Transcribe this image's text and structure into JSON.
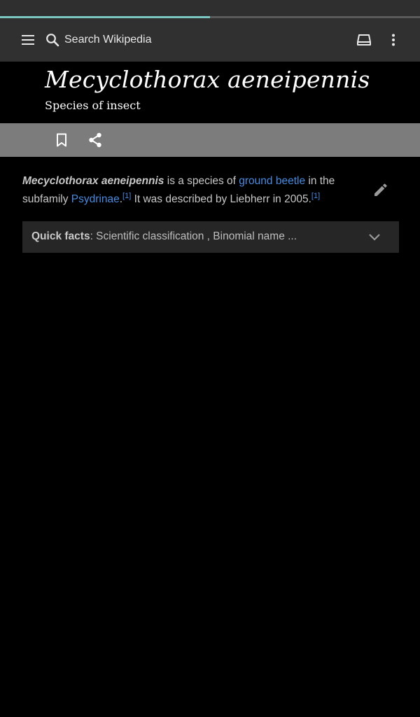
{
  "progress": {
    "fraction": 0.5,
    "color": "#79c7c0"
  },
  "toolbar": {
    "search_placeholder": "Search Wikipedia",
    "icons": [
      "menu-icon",
      "search-icon",
      "reading-list-icon",
      "more-vert-icon"
    ]
  },
  "article": {
    "title": "Mecyclothorax aeneipennis",
    "description": "Species of insect",
    "lead": {
      "bold_name": "Mecyclothorax aeneipennis",
      "text1": " is a species of ",
      "link1": "ground beetle",
      "text2": " in the subfamily ",
      "link2": "Psydrinae",
      "text3": ".",
      "ref1": "[1]",
      "text4": " It was described by Liebherr in 2005.",
      "ref2": "[1]"
    },
    "quick_facts": {
      "label": "Quick facts",
      "summary": ": Scientific classification , Binomial name ..."
    }
  },
  "colors": {
    "toolbar_bg": "#303030",
    "action_bar_bg": "#7c7c7c",
    "link": "#4a8ae0",
    "page_bg": "#000000"
  }
}
